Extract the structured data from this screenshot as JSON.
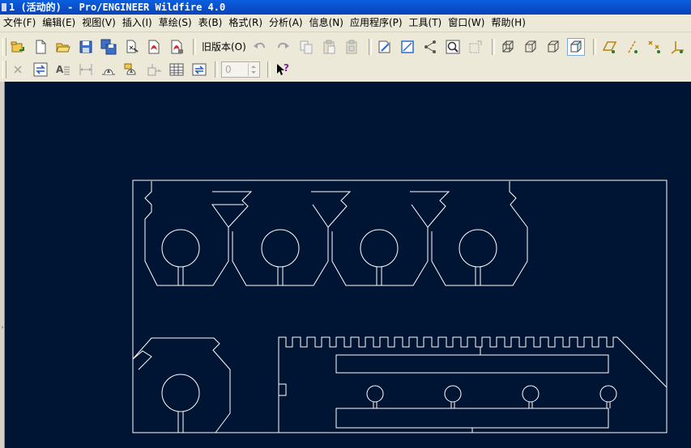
{
  "window": {
    "title": "1 (活动的) - Pro/ENGINEER Wildfire 4.0"
  },
  "menubar": {
    "items": [
      {
        "id": "file",
        "label": "文件(F)"
      },
      {
        "id": "edit",
        "label": "编辑(E)"
      },
      {
        "id": "view",
        "label": "视图(V)"
      },
      {
        "id": "insert",
        "label": "插入(I)"
      },
      {
        "id": "sketch",
        "label": "草绘(S)"
      },
      {
        "id": "table",
        "label": "表(B)"
      },
      {
        "id": "format",
        "label": "格式(R)"
      },
      {
        "id": "analysis",
        "label": "分析(A)"
      },
      {
        "id": "info",
        "label": "信息(N)"
      },
      {
        "id": "applications",
        "label": "应用程序(P)"
      },
      {
        "id": "tools",
        "label": "工具(T)"
      },
      {
        "id": "window",
        "label": "窗口(W)"
      },
      {
        "id": "help",
        "label": "帮助(H)"
      }
    ]
  },
  "toolbar": {
    "legacy_label": "旧版本(O)",
    "spinner_value": "0",
    "icons": [
      "open-recent-icon",
      "new-file-icon",
      "open-folder-icon",
      "save-icon",
      "save-copy-icon",
      "print-icon",
      "export-pdf-icon",
      "export-pdf-settings-icon",
      "undo-icon",
      "redo-icon",
      "copy-icon",
      "paste-icon",
      "paste-special-icon",
      "regenerate-icon",
      "repaint-icon",
      "spin-center-icon",
      "zoom-window-icon",
      "refit-icon",
      "wireframe-icon",
      "hidden-line-icon",
      "no-hidden-icon",
      "shading-icon",
      "datum-plane-display-icon",
      "datum-axis-display-icon",
      "datum-point-display-icon",
      "coord-sys-display-icon",
      "delete-icon",
      "swap-view-icon",
      "text-style-icon",
      "dimension-icon",
      "note-icon",
      "note-with-leader-icon",
      "move-item-icon",
      "table-icon",
      "update-tables-icon",
      "context-help-icon"
    ]
  },
  "colors": {
    "canvas_background": "#001533",
    "drawing_lines": "#ffffff",
    "titlebar": "#0a5fe0",
    "chrome": "#ece9d8"
  }
}
